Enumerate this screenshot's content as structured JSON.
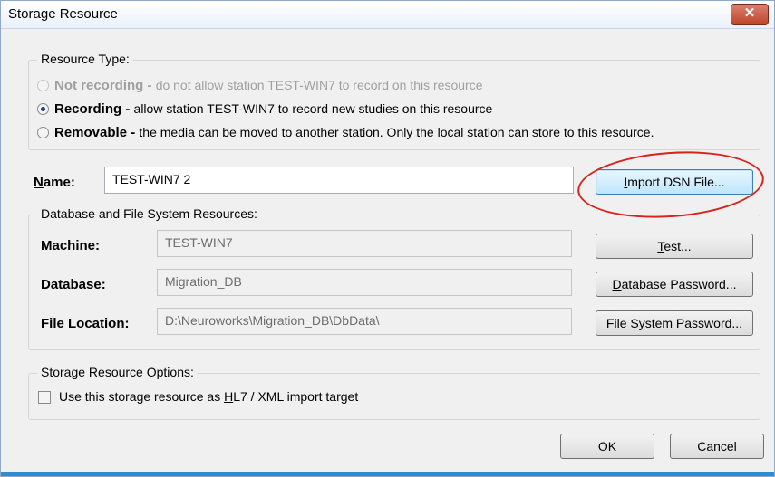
{
  "window": {
    "title": "Storage Resource",
    "close_icon": "close-icon"
  },
  "resource_type": {
    "legend": "Resource Type:",
    "options": [
      {
        "label": "Not recording",
        "sep": " - ",
        "description": "do not allow station TEST-WIN7 to record on this resource",
        "state": "disabled"
      },
      {
        "label": "Recording",
        "sep": " - ",
        "description": "allow station TEST-WIN7 to record new studies on this resource",
        "state": "checked"
      },
      {
        "label": "Removable",
        "sep": " - ",
        "description": "the media can be moved to another station.  Only the local station can store to this resource.",
        "state": "unchecked"
      }
    ]
  },
  "name": {
    "label_first": "N",
    "label_rest": "ame:",
    "value": "TEST-WIN7 2",
    "import_button_first": "I",
    "import_button_rest": "mport DSN File..."
  },
  "db_group": {
    "legend": "Database and File System Resources:",
    "machine_label": "Machine:",
    "machine_value": "TEST-WIN7",
    "database_label": "Database:",
    "database_value": "Migration_DB",
    "file_location_label": "File Location:",
    "file_location_value": "D:\\Neuroworks\\Migration_DB\\DbData\\",
    "test_button_first": "T",
    "test_button_rest": "est...",
    "db_password_first": "D",
    "db_password_rest": "atabase Password...",
    "fs_password_first": "F",
    "fs_password_rest": "ile System Password..."
  },
  "options_group": {
    "legend": "Storage Resource Options:",
    "hl7_before": "Use this storage resource as ",
    "hl7_u": "H",
    "hl7_after": "L7 / XML import target",
    "hl7_checked": false
  },
  "footer": {
    "ok": "OK",
    "cancel": "Cancel"
  },
  "colors": {
    "highlight_ellipse": "#d9241e",
    "accent": "#2d8cd4"
  }
}
